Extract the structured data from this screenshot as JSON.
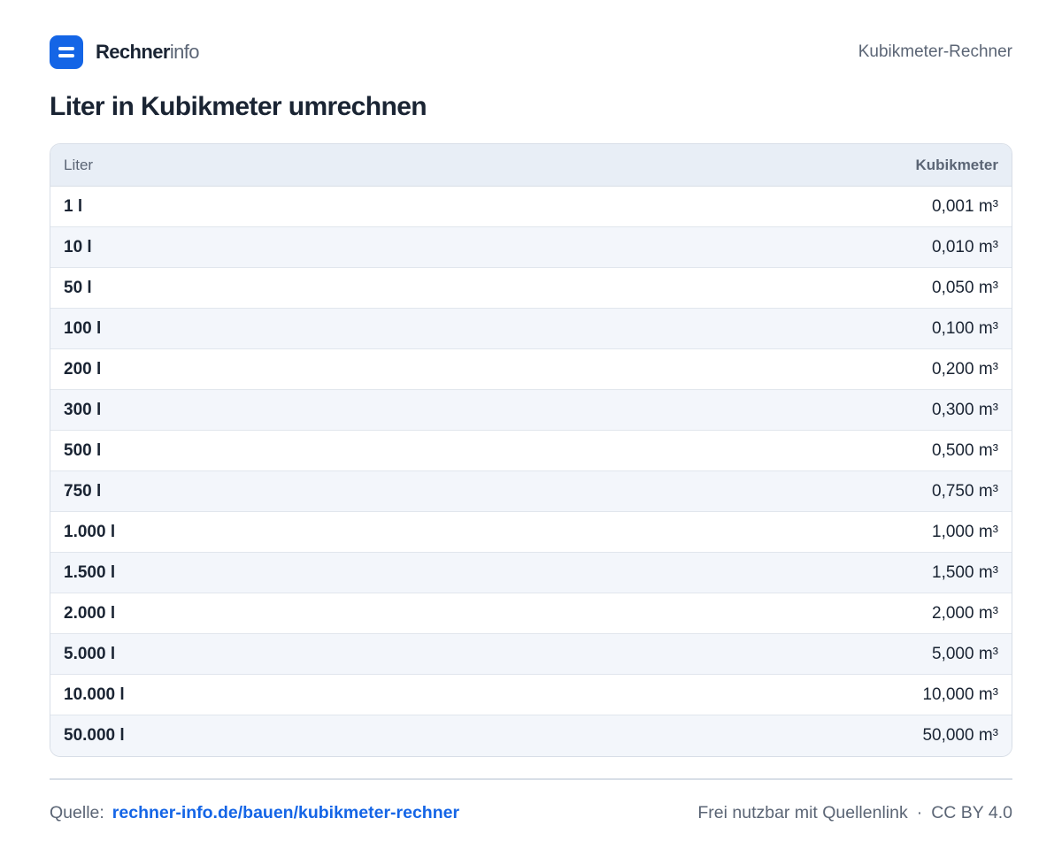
{
  "header": {
    "brand_bold": "Rechner",
    "brand_light": "info",
    "logo_icon": "menu-lines-icon",
    "right_label": "Kubikmeter-Rechner"
  },
  "title": "Liter in Kubikmeter umrechnen",
  "table": {
    "columns": [
      "Liter",
      "Kubikmeter"
    ],
    "rows": [
      [
        "1 l",
        "0,001 m³"
      ],
      [
        "10 l",
        "0,010 m³"
      ],
      [
        "50 l",
        "0,050 m³"
      ],
      [
        "100 l",
        "0,100 m³"
      ],
      [
        "200 l",
        "0,200 m³"
      ],
      [
        "300 l",
        "0,300 m³"
      ],
      [
        "500 l",
        "0,500 m³"
      ],
      [
        "750 l",
        "0,750 m³"
      ],
      [
        "1.000 l",
        "1,000 m³"
      ],
      [
        "1.500 l",
        "1,500 m³"
      ],
      [
        "2.000 l",
        "2,000 m³"
      ],
      [
        "5.000 l",
        "5,000 m³"
      ],
      [
        "10.000 l",
        "10,000 m³"
      ],
      [
        "50.000 l",
        "50,000 m³"
      ]
    ]
  },
  "footer": {
    "source_label": "Quelle:",
    "source_link": "rechner-info.de/bauen/kubikmeter-rechner",
    "license_text": "Frei nutzbar mit Quellenlink",
    "separator": "·",
    "license": "CC BY 4.0"
  },
  "colors": {
    "accent": "#1465e6",
    "text": "#1a2433",
    "muted": "#5b6575",
    "header_bg": "#e8eef6",
    "row_alt": "#f3f6fb"
  }
}
